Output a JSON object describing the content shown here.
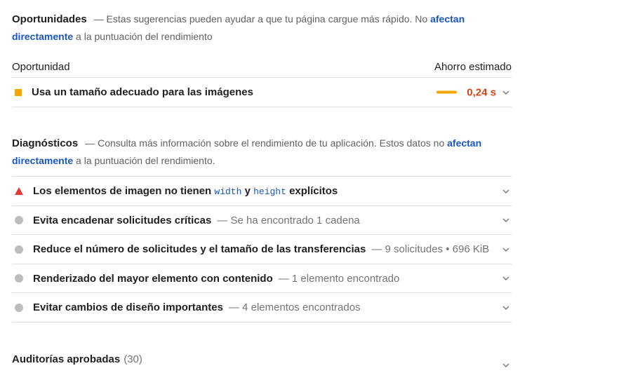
{
  "opportunities": {
    "title": "Oportunidades",
    "desc_prefix": "— Estas sugerencias pueden ayudar a que tu página cargue más rápido. No ",
    "link_text": "afectan directamente",
    "desc_suffix": " a la puntuación del rendimiento",
    "col_left": "Oportunidad",
    "col_right": "Ahorro estimado",
    "items": [
      {
        "label": "Usa un tamaño adecuado para las imágenes",
        "savings": "0,24 s",
        "savings_fraction": 0.15,
        "color": "#f5a500"
      }
    ]
  },
  "diagnostics": {
    "title": "Diagnósticos",
    "desc_prefix": "— Consulta más información sobre el rendimiento de tu aplicación. Estos datos no ",
    "link_text": "afectan directamente",
    "desc_suffix": " a la puntuación del rendimiento.",
    "items": [
      {
        "label_a": "Los elementos de imagen no tienen ",
        "code_a": "width",
        "label_b": " y ",
        "code_b": "height",
        "label_c": " explícitos",
        "icon": "warning-triangle-icon",
        "color": "#e53935"
      },
      {
        "label": "Evita encadenar solicitudes críticas",
        "sub": "— Se ha encontrado 1 cadena",
        "icon": "info-dot-icon"
      },
      {
        "label": "Reduce el número de solicitudes y el tamaño de las transferencias",
        "sub": "— 9 solicitudes • 696 KiB",
        "icon": "info-dot-icon"
      },
      {
        "label": "Renderizado del mayor elemento con contenido",
        "sub": "— 1 elemento encontrado",
        "icon": "info-dot-icon"
      },
      {
        "label": "Evitar cambios de diseño importantes",
        "sub": "— 4 elementos encontrados",
        "icon": "info-dot-icon"
      }
    ]
  },
  "passed": {
    "title": "Auditorías aprobadas",
    "count": "(30)"
  }
}
